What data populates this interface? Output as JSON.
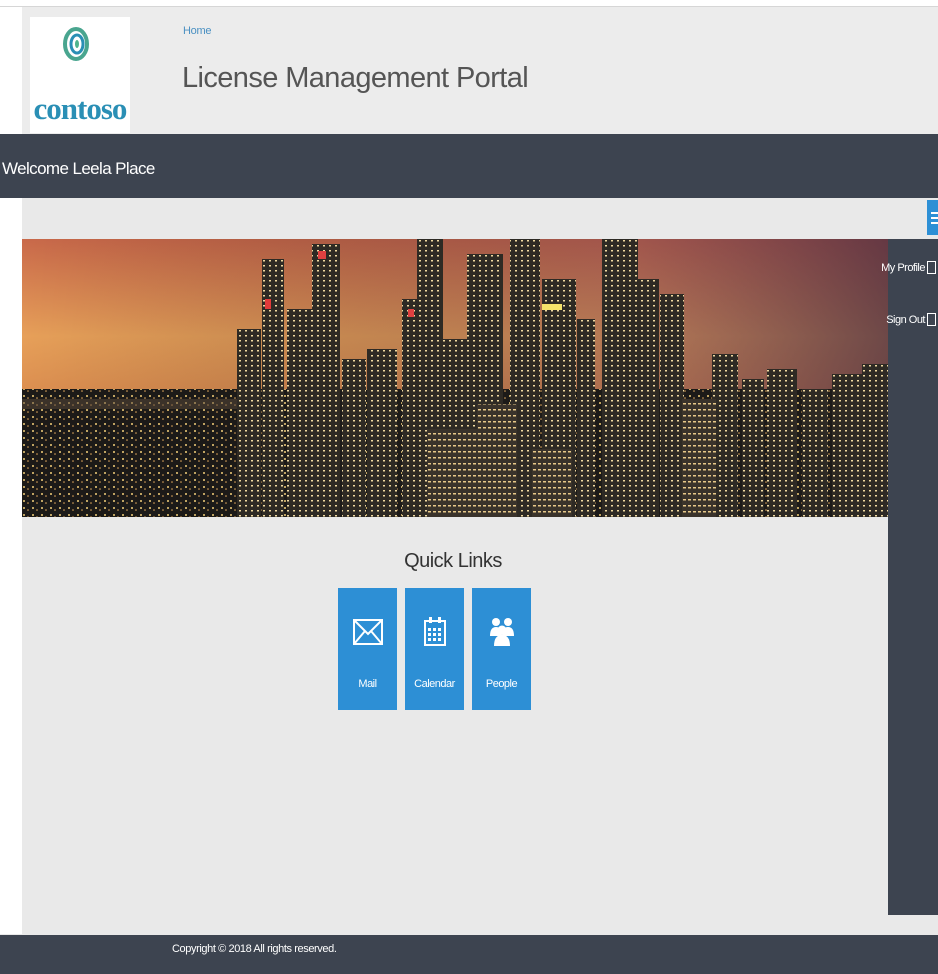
{
  "header": {
    "breadcrumb": "Home",
    "title": "License Management Portal",
    "logo": {
      "text": "contoso",
      "icon": "contoso-ring-logo",
      "color": "#2a8fb5"
    }
  },
  "welcome": {
    "text": "Welcome Leela Place"
  },
  "menu_toggle": {
    "icon": "hamburger-icon",
    "color": "#2d8fd5"
  },
  "side_panel": {
    "items": [
      {
        "label": "My Profile",
        "icon": "profile-icon"
      },
      {
        "label": "Sign Out",
        "icon": "sign-out-icon"
      }
    ]
  },
  "banner": {
    "description_icon": "city-skyline-image"
  },
  "quick_links": {
    "title": "Quick Links",
    "tiles": [
      {
        "label": "Mail",
        "icon": "mail-icon"
      },
      {
        "label": "Calendar",
        "icon": "calendar-icon"
      },
      {
        "label": "People",
        "icon": "people-icon"
      }
    ]
  },
  "footer": {
    "text": "Copyright © 2018 All rights reserved."
  },
  "colors": {
    "accent": "#2d8fd5",
    "dark_bar": "#3d4450",
    "background": "#e9e9e9"
  }
}
